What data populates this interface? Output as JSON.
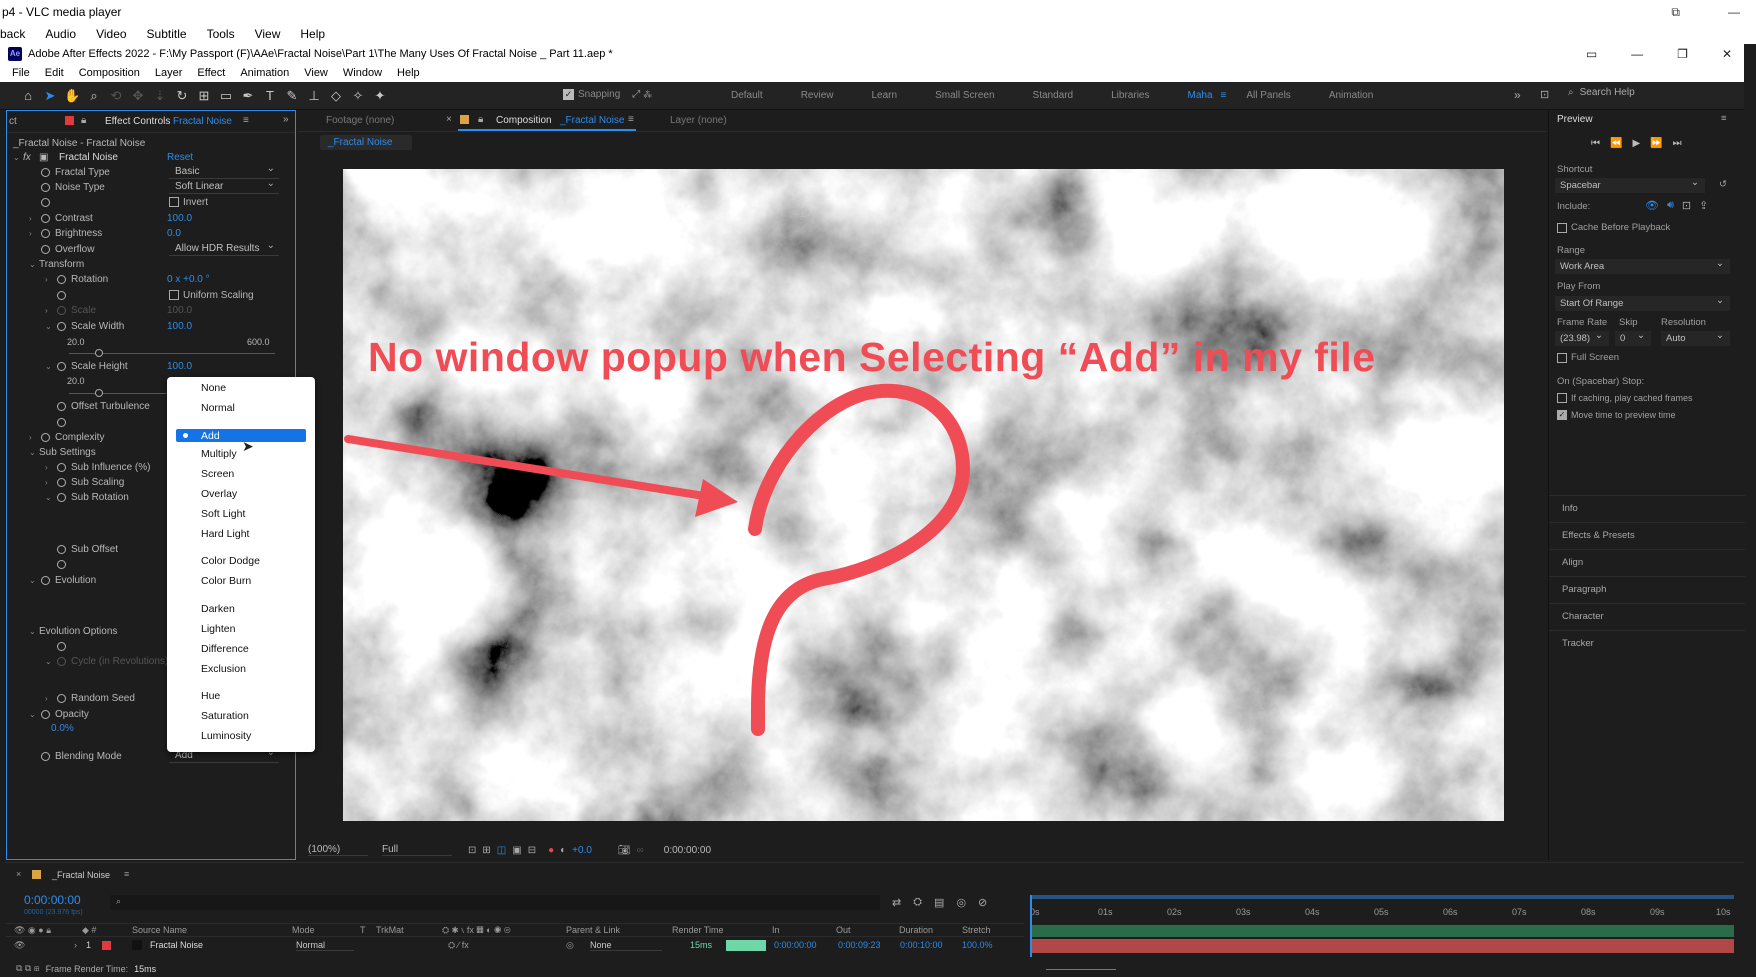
{
  "vlc": {
    "title": "p4 - VLC media player",
    "menu": [
      "back",
      "Audio",
      "Video",
      "Subtitle",
      "Tools",
      "View",
      "Help"
    ]
  },
  "ae": {
    "title": "Adobe After Effects 2022 - F:\\My Passport (F)\\AAe\\Fractal Noise\\Part 1\\The Many Uses Of Fractal Noise _ Part 11.aep *",
    "menu": [
      "File",
      "Edit",
      "Composition",
      "Layer",
      "Effect",
      "Animation",
      "View",
      "Window",
      "Help"
    ],
    "snapping": "Snapping",
    "workspaces": [
      "Default",
      "Review",
      "Learn",
      "Small Screen",
      "Standard",
      "Libraries",
      "Maha",
      "All Panels",
      "Animation"
    ],
    "active_workspace": "Maha",
    "search_help": "Search Help"
  },
  "effect_controls": {
    "tab_prefix": "ct",
    "tab_label": "Effect Controls",
    "tab_layer": "Fractal Noise",
    "header": "_Fractal Noise - Fractal Noise",
    "effect_name": "Fractal Noise",
    "reset": "Reset",
    "props": {
      "fractal_type": "Fractal Type",
      "fractal_type_val": "Basic",
      "noise_type": "Noise Type",
      "noise_type_val": "Soft Linear",
      "invert": "Invert",
      "contrast": "Contrast",
      "contrast_val": "100.0",
      "brightness": "Brightness",
      "brightness_val": "0.0",
      "overflow": "Overflow",
      "overflow_val": "Allow HDR Results",
      "transform": "Transform",
      "rotation": "Rotation",
      "rotation_val": "0 x +0.0 °",
      "uniform_scaling": "Uniform Scaling",
      "scale": "Scale",
      "scale_val": "100.0",
      "scale_width": "Scale Width",
      "scale_width_val": "100.0",
      "sw_min": "20.0",
      "sw_max": "600.0",
      "scale_height": "Scale Height",
      "scale_height_val": "100.0",
      "sh_min": "20.0",
      "offset_turbulence": "Offset Turbulence",
      "complexity": "Complexity",
      "sub_settings": "Sub Settings",
      "sub_influence": "Sub Influence (%)",
      "sub_scaling": "Sub Scaling",
      "sub_rotation": "Sub Rotation",
      "sub_offset": "Sub Offset",
      "evolution": "Evolution",
      "evolution_options": "Evolution Options",
      "cycle": "Cycle (in Revolutions)",
      "random_seed": "Random Seed",
      "opacity": "Opacity",
      "opacity_val": "0.0%",
      "blending_mode": "Blending Mode",
      "blending_mode_val": "Add"
    }
  },
  "blend_menu": {
    "items": [
      "None",
      "Normal",
      "Add",
      "Multiply",
      "Screen",
      "Overlay",
      "Soft Light",
      "Hard Light",
      "Color Dodge",
      "Color Burn",
      "Darken",
      "Lighten",
      "Difference",
      "Exclusion",
      "Hue",
      "Saturation",
      "Luminosity"
    ],
    "selected": "Add"
  },
  "comp": {
    "footage_tab": "Footage (none)",
    "comp_tab_label": "Composition",
    "comp_tab_name": "_Fractal Noise",
    "layer_tab": "Layer (none)",
    "breadcrumb": "_Fractal Noise",
    "zoom": "(100%)",
    "resolution": "Full",
    "exposure": "+0.0",
    "timecode": "0:00:00:00",
    "annotation": "No window popup when Selecting “Add” in my file"
  },
  "preview": {
    "title": "Preview",
    "shortcut_label": "Shortcut",
    "shortcut_val": "Spacebar",
    "include_label": "Include:",
    "cache_before": "Cache Before Playback",
    "range_label": "Range",
    "range_val": "Work Area",
    "play_from_label": "Play From",
    "play_from_val": "Start Of Range",
    "frame_rate_label": "Frame Rate",
    "skip_label": "Skip",
    "resolution_label": "Resolution",
    "frame_rate_val": "(23.98)",
    "skip_val": "0",
    "resolution_val": "Auto",
    "full_screen": "Full Screen",
    "on_stop": "On (Spacebar) Stop:",
    "if_caching": "If caching, play cached frames",
    "move_time": "Move time to preview time",
    "sections": [
      "Info",
      "Effects & Presets",
      "Align",
      "Paragraph",
      "Character",
      "Tracker"
    ]
  },
  "timeline": {
    "comp_name": "_Fractal Noise",
    "timecode": "0:00:00:00",
    "fps": "00000 (23.976 fps)",
    "columns": {
      "source_name": "Source Name",
      "mode": "Mode",
      "t": "T",
      "trkmat": "TrkMat",
      "parent": "Parent & Link",
      "render_time": "Render Time",
      "in": "In",
      "out": "Out",
      "duration": "Duration",
      "stretch": "Stretch"
    },
    "layer": {
      "num": "1",
      "name": "Fractal Noise",
      "mode": "Normal",
      "parent": "None",
      "render_time": "15ms",
      "in": "0:00:00:00",
      "out": "0:00:09:23",
      "duration": "0:00:10:00",
      "stretch": "100.0%"
    },
    "ruler": [
      "0s",
      "01s",
      "02s",
      "03s",
      "04s",
      "05s",
      "06s",
      "07s",
      "08s",
      "09s",
      "10s"
    ],
    "frame_render_label": "Frame Render Time:",
    "frame_render_val": "15ms"
  },
  "colors": {
    "accent": "#2d8ceb",
    "annotation": "#f04c55",
    "render_bar": "#6fd6a8",
    "layer_bar": "#b04848"
  }
}
